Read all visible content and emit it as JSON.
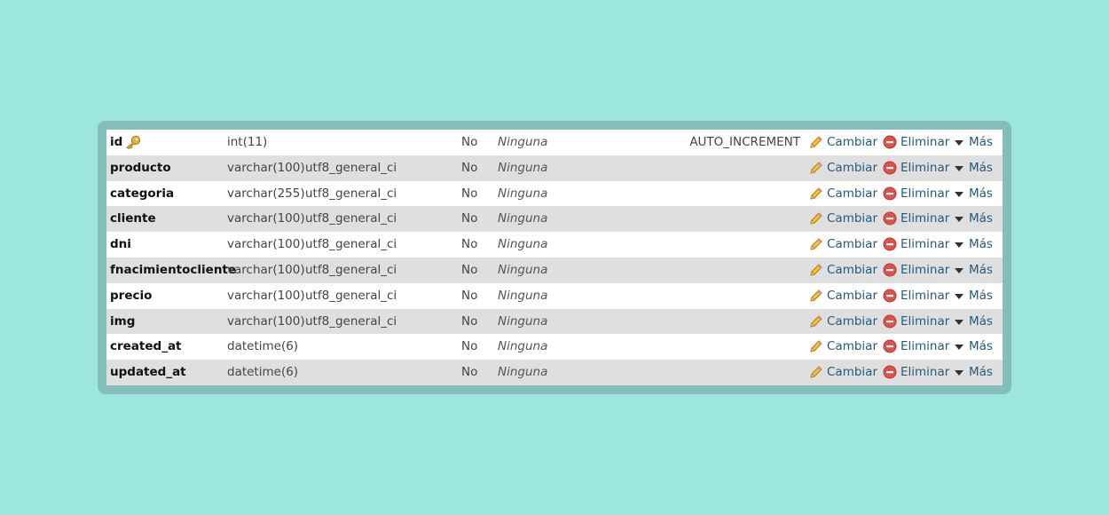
{
  "actions": {
    "change": "Cambiar",
    "drop": "Eliminar",
    "more": "Más"
  },
  "rows": [
    {
      "name": "id",
      "type": "int(11)",
      "collation": "",
      "null": "No",
      "default": "Ninguna",
      "extra": "AUTO_INCREMENT",
      "primary_key": true
    },
    {
      "name": "producto",
      "type": "varchar(100)",
      "collation": "utf8_general_ci",
      "null": "No",
      "default": "Ninguna",
      "extra": ""
    },
    {
      "name": "categoria",
      "type": "varchar(255)",
      "collation": "utf8_general_ci",
      "null": "No",
      "default": "Ninguna",
      "extra": ""
    },
    {
      "name": "cliente",
      "type": "varchar(100)",
      "collation": "utf8_general_ci",
      "null": "No",
      "default": "Ninguna",
      "extra": ""
    },
    {
      "name": "dni",
      "type": "varchar(100)",
      "collation": "utf8_general_ci",
      "null": "No",
      "default": "Ninguna",
      "extra": ""
    },
    {
      "name": "fnacimientocliente",
      "type": "varchar(100)",
      "collation": "utf8_general_ci",
      "null": "No",
      "default": "Ninguna",
      "extra": ""
    },
    {
      "name": "precio",
      "type": "varchar(100)",
      "collation": "utf8_general_ci",
      "null": "No",
      "default": "Ninguna",
      "extra": ""
    },
    {
      "name": "img",
      "type": "varchar(100)",
      "collation": "utf8_general_ci",
      "null": "No",
      "default": "Ninguna",
      "extra": ""
    },
    {
      "name": "created_at",
      "type": "datetime(6)",
      "collation": "",
      "null": "No",
      "default": "Ninguna",
      "extra": ""
    },
    {
      "name": "updated_at",
      "type": "datetime(6)",
      "collation": "",
      "null": "No",
      "default": "Ninguna",
      "extra": ""
    }
  ],
  "colors": {
    "background": "#9de6df",
    "frame": "#83bfb8",
    "link": "#235a81",
    "row_alt": "#dfdfdf"
  },
  "icons": {
    "primary_key": "key-icon",
    "change": "pencil-icon",
    "drop": "drop-icon",
    "more": "triangle-down-icon"
  }
}
